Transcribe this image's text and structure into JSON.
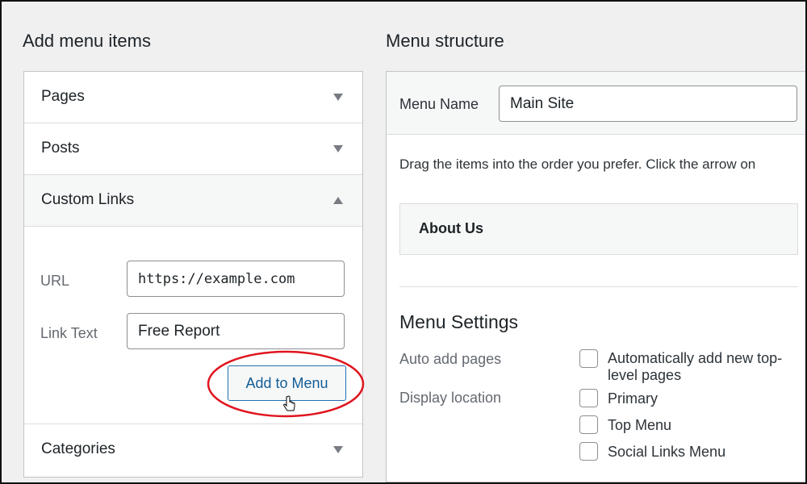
{
  "left": {
    "title": "Add menu items",
    "sections": [
      {
        "label": "Pages"
      },
      {
        "label": "Posts"
      },
      {
        "label": "Custom Links"
      },
      {
        "label": "Categories"
      }
    ],
    "custom_links": {
      "url_label": "URL",
      "url_value": "https://example.com",
      "link_text_label": "Link Text",
      "link_text_value": "Free Report",
      "add_button": "Add to Menu"
    }
  },
  "right": {
    "title": "Menu structure",
    "menu_name_label": "Menu Name",
    "menu_name_value": "Main Site",
    "instructions": "Drag the items into the order you prefer. Click the arrow on",
    "menu_items": [
      {
        "label": "About Us"
      }
    ],
    "settings": {
      "title": "Menu Settings",
      "auto_add_label": "Auto add pages",
      "auto_add_option": "Automatically add new top-level pages",
      "display_location_label": "Display location",
      "locations": [
        {
          "label": "Primary",
          "checked": false
        },
        {
          "label": "Top Menu",
          "checked": false
        },
        {
          "label": "Social Links Menu",
          "checked": false
        }
      ]
    }
  },
  "highlight_color": "#e0141e",
  "accent": "#2271b1"
}
